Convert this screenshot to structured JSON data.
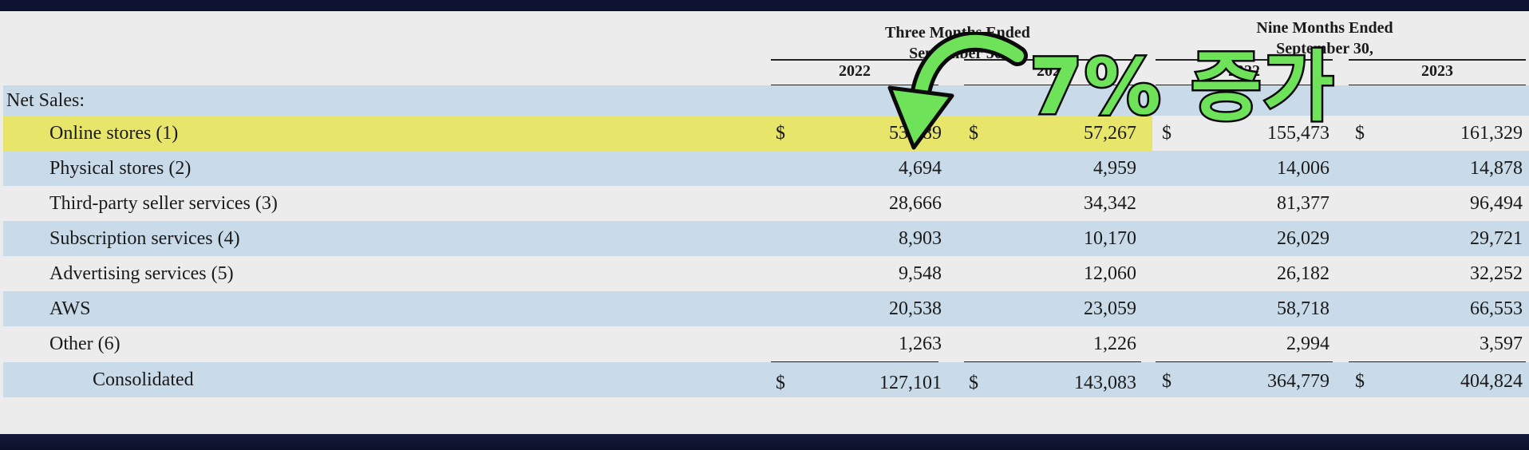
{
  "header": {
    "three_months_l1": "Three Months Ended",
    "three_months_l2": "September 30,",
    "nine_months_l1": "Nine Months Ended",
    "nine_months_l2": "September 30,",
    "years": [
      "2022",
      "2023",
      "2022",
      "2023"
    ]
  },
  "section_title": "Net Sales:",
  "currency_symbol": "$",
  "rows": [
    {
      "label": "Online stores (1)",
      "values": [
        "53,489",
        "57,267",
        "155,473",
        "161,329"
      ]
    },
    {
      "label": "Physical stores (2)",
      "values": [
        "4,694",
        "4,959",
        "14,006",
        "14,878"
      ]
    },
    {
      "label": "Third-party seller services (3)",
      "values": [
        "28,666",
        "34,342",
        "81,377",
        "96,494"
      ]
    },
    {
      "label": "Subscription services (4)",
      "values": [
        "8,903",
        "10,170",
        "26,029",
        "29,721"
      ]
    },
    {
      "label": "Advertising services (5)",
      "values": [
        "9,548",
        "12,060",
        "26,182",
        "32,252"
      ]
    },
    {
      "label": "AWS",
      "values": [
        "20,538",
        "23,059",
        "58,718",
        "66,553"
      ]
    },
    {
      "label": "Other (6)",
      "values": [
        "1,263",
        "1,226",
        "2,994",
        "3,597"
      ]
    }
  ],
  "total": {
    "label": "Consolidated",
    "values": [
      "127,101",
      "143,083",
      "364,779",
      "404,824"
    ]
  },
  "annotation": {
    "text": "7% 증가",
    "color": "#6ee35a"
  },
  "colors": {
    "row_band": "#c9dbe8",
    "highlight": "#e7e66a",
    "background": "#ececec",
    "frame": "#0d1230"
  }
}
